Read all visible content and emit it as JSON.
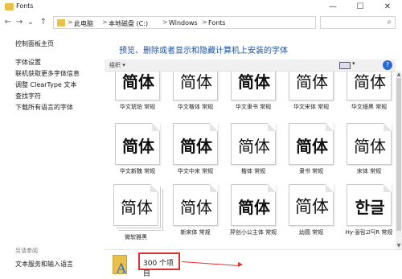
{
  "window": {
    "title": "Fonts",
    "minimize": "—",
    "maximize": "☐",
    "close": "✕"
  },
  "nav": {
    "back": "←",
    "forward": "→",
    "recent": "⌄",
    "up": "↑",
    "crumbs": [
      "此电脑",
      "本地磁盘 (C:)",
      "Windows",
      "Fonts"
    ],
    "separator": ">",
    "search_icon": "⌕"
  },
  "sidebar": {
    "top_link": "控制面板主页",
    "links": [
      "字体设置",
      "联机获取更多字体信息",
      "调整 ClearType 文本",
      "查找字符",
      "下载所有语言的字体"
    ],
    "see_also": "另请参阅",
    "see_also_links": [
      "文本服务和输入语言"
    ]
  },
  "main": {
    "heading": "预览、删除或者显示和隐藏计算机上安装的字体",
    "organize": "组织 ▾",
    "view_caret": "▾",
    "help": "?"
  },
  "fonts": [
    {
      "glyph": "简体",
      "label": "华文琥珀 常规",
      "stack": false
    },
    {
      "glyph": "简体",
      "label": "华文楷体 常规",
      "stack": false
    },
    {
      "glyph": "简体",
      "label": "华文隶书 常规",
      "stack": false
    },
    {
      "glyph": "简体",
      "label": "华文宋体 常规",
      "stack": false
    },
    {
      "glyph": "简体",
      "label": "华文细黑 常规",
      "stack": false
    },
    {
      "glyph": "简体",
      "label": "华文新魏 常规",
      "stack": false
    },
    {
      "glyph": "简体",
      "label": "华文中宋 常规",
      "stack": false
    },
    {
      "glyph": "简体",
      "label": "楷体 常规",
      "stack": false
    },
    {
      "glyph": "简体",
      "label": "隶书 常规",
      "stack": false
    },
    {
      "glyph": "简体",
      "label": "宋体 常规",
      "stack": false
    },
    {
      "glyph": "简体",
      "label": "微软雅黑",
      "stack": true
    },
    {
      "glyph": "简体",
      "label": "新宋体 常规",
      "stack": false
    },
    {
      "glyph": "简体",
      "label": "羿创小公主体 常规",
      "stack": false
    },
    {
      "glyph": "简体",
      "label": "幼圆 常规",
      "stack": false
    },
    {
      "glyph": "한글",
      "label": "Hy-올림고딕R 常规",
      "stack": false
    }
  ],
  "status": {
    "count": "300 个项目",
    "icon_letter": "A"
  },
  "colors": {
    "annotation": "#e03030",
    "heading": "#1a4f9c",
    "folder": "#e8c04a"
  }
}
